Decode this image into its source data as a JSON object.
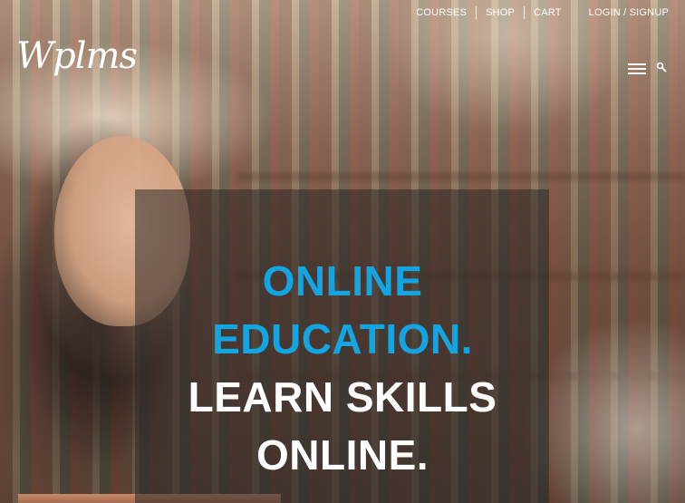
{
  "topnav": {
    "links": [
      "COURSES",
      "SHOP",
      "CART",
      "LOGIN / SIGNUP"
    ]
  },
  "logo": {
    "text": "Wplms"
  },
  "icons": {
    "menu": "hamburger-menu-icon",
    "search": "search-icon"
  },
  "hero": {
    "line1": "ONLINE",
    "line2": "EDUCATION.",
    "line3": "LEARN SKILLS",
    "line4": "ONLINE."
  },
  "colors": {
    "accent": "#12a5e2",
    "text_light": "#ffffff",
    "overlay": "#2d2826"
  }
}
